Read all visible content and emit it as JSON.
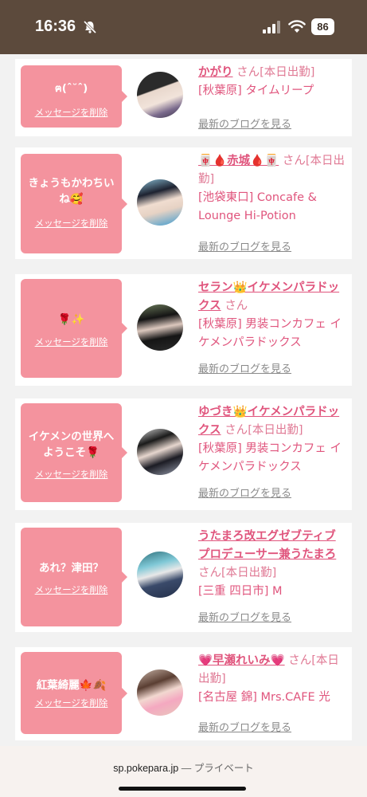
{
  "status": {
    "time": "16:36",
    "battery": "86"
  },
  "browser": {
    "url": "sp.pokepara.jp",
    "mode": "— プライベート"
  },
  "cards": [
    {
      "message": "ฅ(ˆ˘ˆ)",
      "delete_label": "メッセージを削除",
      "name": "かがり",
      "san": "さん",
      "status": "[本日出勤]",
      "area": "[秋葉原] タイムリープ",
      "blog_label": "最新のブログを見る"
    },
    {
      "message": "きょうもかわちいね🥰",
      "delete_label": "メッセージを削除",
      "name": "🀄🩸赤城🩸🀄",
      "san": "さん",
      "status": "[本日出勤]",
      "area": "[池袋東口] Concafe & Lounge Hi-Potion",
      "blog_label": "最新のブログを見る"
    },
    {
      "message": "🌹✨",
      "delete_label": "メッセージを削除",
      "name": "セラン👑イケメンパラドックス",
      "san": "さん",
      "status": "",
      "area": "[秋葉原] 男装コンカフェ イケメンパラドックス",
      "blog_label": "最新のブログを見る"
    },
    {
      "message": "イケメンの世界へようこそ🌹",
      "delete_label": "メッセージを削除",
      "name": "ゆづき👑イケメンパラドックス",
      "san": "さん",
      "status": "[本日出勤]",
      "area": "[秋葉原] 男装コンカフェ イケメンパラドックス",
      "blog_label": "最新のブログを見る"
    },
    {
      "message": "あれ？津田？",
      "delete_label": "メッセージを削除",
      "name": "うたまろ改エグゼブティブプロデューサー兼うたまろ",
      "san": "さん",
      "status": "[本日出勤]",
      "area": "[三重 四日市] M",
      "blog_label": "最新のブログを見る"
    },
    {
      "message": "紅葉綺麗🍁🍂",
      "delete_label": "メッセージを削除",
      "name": "💗早瀬れいみ💗",
      "san": "さん",
      "status": "[本日出勤]",
      "area": "[名古屋 錦] Mrs.CAFE 光",
      "blog_label": "最新のブログを見る"
    }
  ]
}
